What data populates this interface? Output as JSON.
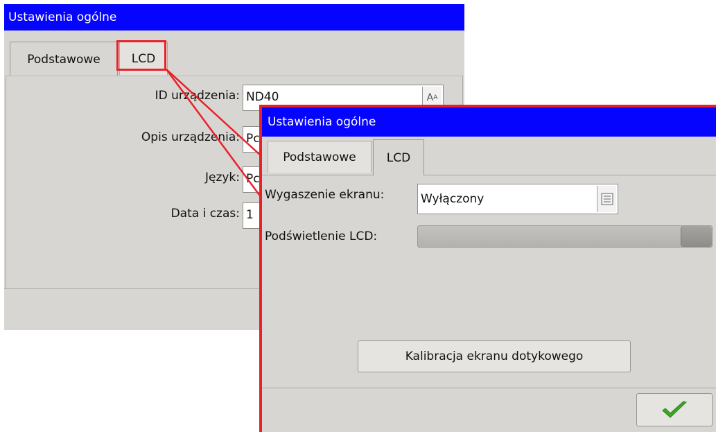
{
  "back": {
    "title": "Ustawienia ogólne",
    "tabs": [
      "Podstawowe",
      "LCD"
    ],
    "fields": [
      {
        "label": "ID urządzenia:",
        "value": "ND40",
        "button_icon": "text-input-icon"
      },
      {
        "label": "Opis urządzenia:",
        "value": "Pc"
      },
      {
        "label": "Język:",
        "value": "Pc"
      },
      {
        "label": "Data i czas:",
        "value": "1"
      }
    ]
  },
  "front": {
    "title": "Ustawienia ogólne",
    "tabs": [
      "Podstawowe",
      "LCD"
    ],
    "screen_blanking": {
      "label": "Wygaszenie ekranu:",
      "value": "Wyłączony",
      "button_icon": "list-icon"
    },
    "backlight": {
      "label": "Podświetlenie LCD:",
      "level": 1.0
    },
    "calibrate_button": "Kalibracja ekranu dotykowego",
    "ok_icon": "checkmark-icon"
  },
  "colors": {
    "titlebar": "#0505ff",
    "highlight": "#e8202a",
    "window": "#d8d6d2",
    "ok_green": "#3aa820"
  }
}
